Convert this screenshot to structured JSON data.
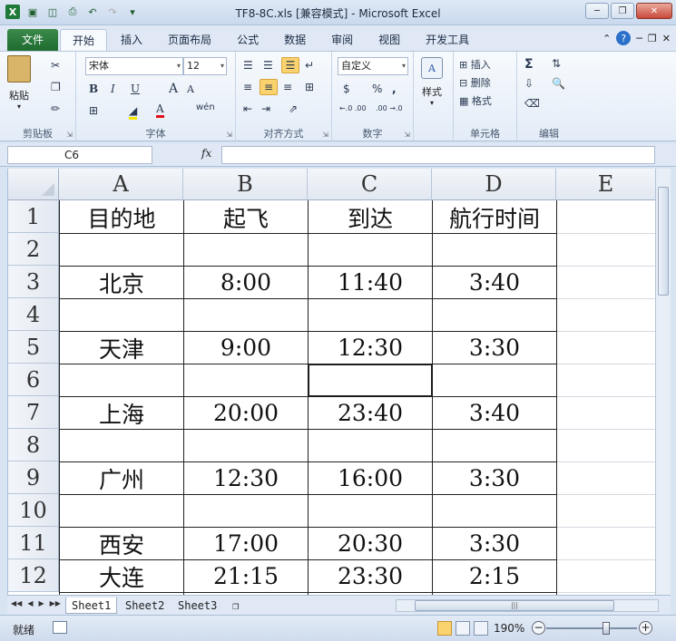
{
  "window": {
    "title": "TF8-8C.xls  [兼容模式] - Microsoft Excel"
  },
  "ribbon_tabs": [
    "文件",
    "开始",
    "插入",
    "页面布局",
    "公式",
    "数据",
    "审阅",
    "视图",
    "开发工具"
  ],
  "ribbon": {
    "clipboard": {
      "label": "剪贴板",
      "paste": "粘贴"
    },
    "font": {
      "label": "字体",
      "name": "宋体",
      "size": "12",
      "bold": "B",
      "italic": "I",
      "underline": "U",
      "grow": "A",
      "shrink": "A",
      "color_a": "A",
      "wen": "wén"
    },
    "alignment": {
      "label": "对齐方式"
    },
    "number": {
      "label": "数字",
      "format": "自定义",
      "currency": "$",
      "percent": "%",
      "comma": ",",
      "inc_dec": "←.0 .00",
      "dec_dec": ".00 →.0"
    },
    "styles": {
      "label": "样式"
    },
    "cells": {
      "label": "单元格",
      "insert": "插入",
      "delete": "删除",
      "format": "格式"
    },
    "editing": {
      "label": "编辑",
      "sum": "Σ"
    }
  },
  "formula_bar": {
    "name_box": "C6",
    "fx": "fx",
    "content": ""
  },
  "sheet": {
    "columns": [
      "A",
      "B",
      "C",
      "D",
      "E"
    ],
    "rows": [
      "1",
      "2",
      "3",
      "4",
      "5",
      "6",
      "7",
      "8",
      "9",
      "10",
      "11",
      "12"
    ],
    "cells": {
      "r1": [
        "目的地",
        "起飞",
        "到达",
        "航行时间"
      ],
      "r2": [
        "",
        "",
        "",
        ""
      ],
      "r3": [
        "北京",
        "8:00",
        "11:40",
        "3:40"
      ],
      "r4": [
        "",
        "",
        "",
        ""
      ],
      "r5": [
        "天津",
        "9:00",
        "12:30",
        "3:30"
      ],
      "r6": [
        "",
        "",
        "",
        ""
      ],
      "r7": [
        "上海",
        "20:00",
        "23:40",
        "3:40"
      ],
      "r8": [
        "",
        "",
        "",
        ""
      ],
      "r9": [
        "广州",
        "12:30",
        "16:00",
        "3:30"
      ],
      "r10": [
        "",
        "",
        "",
        ""
      ],
      "r11": [
        "西安",
        "17:00",
        "20:30",
        "3:30"
      ],
      "r12": [
        "大连",
        "21:15",
        "23:30",
        "2:15"
      ]
    }
  },
  "sheet_tabs": [
    "Sheet1",
    "Sheet2",
    "Sheet3"
  ],
  "status_bar": {
    "ready": "就绪",
    "zoom": "190%",
    "zoom_minus": "−",
    "zoom_plus": "+"
  },
  "colors": {
    "file_tab": "#1f6b30",
    "selected_button": "#fbd36e",
    "grid_line": "#d4d9e1",
    "border_line": "#222222"
  }
}
